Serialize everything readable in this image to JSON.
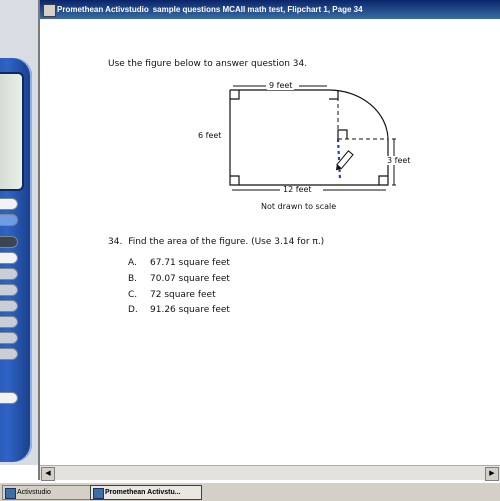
{
  "window": {
    "title_app": "Promethean Activstudio",
    "title_doc": "sample questions MCAII math test, Flipchart 1, Page 34"
  },
  "question": {
    "intro": "Use the figure below to answer question 34.",
    "figure": {
      "top_label": "9 feet",
      "left_label": "6 feet",
      "right_label": "3 feet",
      "bottom_label": "12 feet",
      "caption": "Not drawn to scale"
    },
    "number": "34.",
    "stem": "Find the area of the figure. (Use 3.14 for π.)",
    "choices": [
      {
        "letter": "A.",
        "text": "67.71 square feet"
      },
      {
        "letter": "B.",
        "text": "70.07 square feet"
      },
      {
        "letter": "C.",
        "text": "72 square feet"
      },
      {
        "letter": "D.",
        "text": "91.26 square feet"
      }
    ]
  },
  "taskbar": {
    "items": [
      {
        "label": "Activstudio"
      },
      {
        "label": "Promethean Activstu..."
      }
    ]
  },
  "colors": {
    "titlebar": "#0a246a",
    "calculator": "#2e64c7",
    "annotation_pen": "#1f3fbf"
  }
}
